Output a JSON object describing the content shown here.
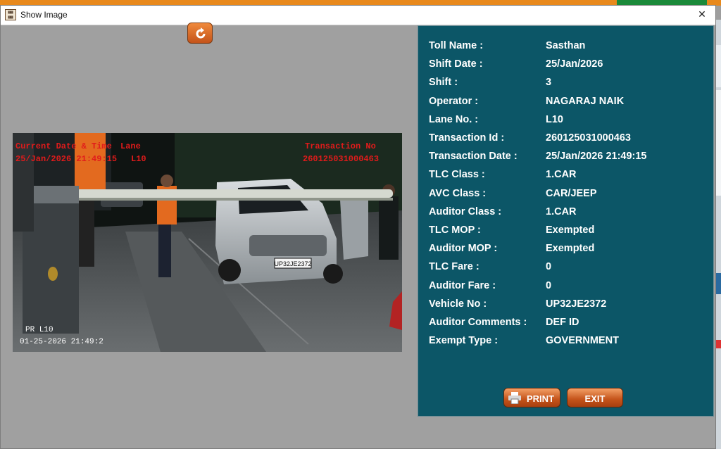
{
  "window": {
    "title": "Show Image",
    "icon": "app-logo-icon"
  },
  "photo": {
    "overlay_left_header": "Current Date & Time",
    "overlay_lane_header": "Lane",
    "overlay_datetime": "25/Jan/2026 21:49:15",
    "overlay_lane": "L10",
    "overlay_txn_header": "Transaction No",
    "overlay_txn": "260125031000463",
    "camera_label": "PR L10",
    "camera_timestamp": "01-25-2026 21:49:2",
    "plate": "UP32JE2372"
  },
  "details": [
    {
      "label": "Toll Name :",
      "value": "Sasthan"
    },
    {
      "label": "Shift Date :",
      "value": "25/Jan/2026"
    },
    {
      "label": "Shift :",
      "value": "3"
    },
    {
      "label": "Operator :",
      "value": "NAGARAJ NAIK"
    },
    {
      "label": "Lane No. :",
      "value": "L10"
    },
    {
      "label": "Transaction Id :",
      "value": "260125031000463"
    },
    {
      "label": "Transaction Date :",
      "value": "25/Jan/2026 21:49:15"
    },
    {
      "label": "TLC Class :",
      "value": "1.CAR"
    },
    {
      "label": "AVC Class :",
      "value": "CAR/JEEP"
    },
    {
      "label": "Auditor Class :",
      "value": "1.CAR"
    },
    {
      "label": "TLC MOP :",
      "value": "Exempted"
    },
    {
      "label": "Auditor MOP :",
      "value": "Exempted"
    },
    {
      "label": "TLC Fare :",
      "value": "0"
    },
    {
      "label": "Auditor Fare :",
      "value": "0"
    },
    {
      "label": "Vehicle No :",
      "value": "UP32JE2372"
    },
    {
      "label": "Auditor Comments :",
      "value": "DEF ID"
    },
    {
      "label": "Exempt Type :",
      "value": "GOVERNMENT"
    }
  ],
  "buttons": {
    "print": "PRINT",
    "exit": "EXIT"
  },
  "colors": {
    "panel": "#0c5667",
    "button": "#c4531a",
    "overlay_text": "#e11b1b"
  }
}
